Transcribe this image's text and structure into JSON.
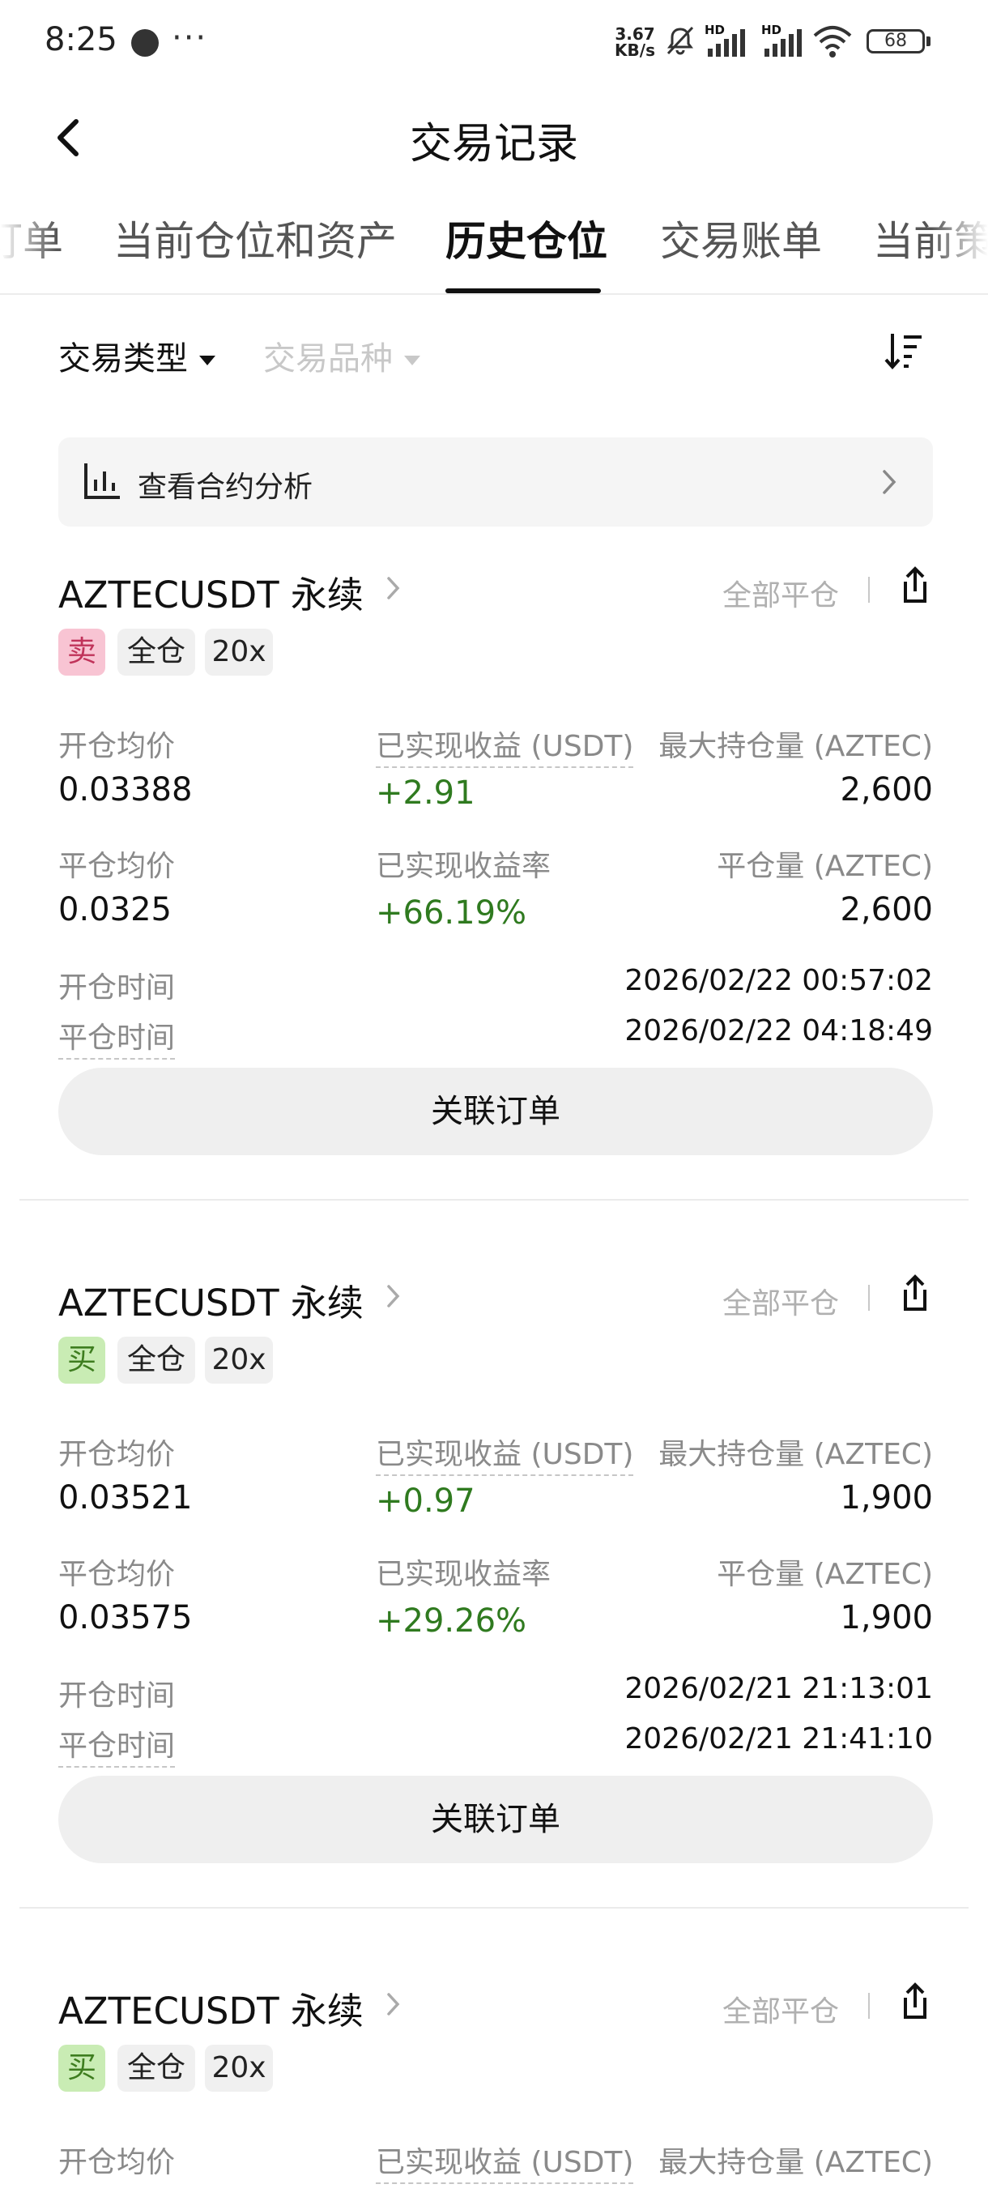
{
  "status_bar": {
    "time": "8:25",
    "dots": "···",
    "speed": "3.67 KB/s",
    "battery": "68",
    "signal1_label": "HD",
    "signal2_label": "HD"
  },
  "nav": {
    "title": "交易记录",
    "back_icon": "chevron-left-icon"
  },
  "tabs": [
    {
      "label": "订单"
    },
    {
      "label": "当前仓位和资产"
    },
    {
      "label": "历史仓位"
    },
    {
      "label": "交易账单"
    },
    {
      "label": "当前策"
    }
  ],
  "filters": {
    "type_label": "交易类型",
    "symbol_label": "交易品种",
    "sort_icon": "sort-descending-icon"
  },
  "analysis": {
    "label": "查看合约分析",
    "icon": "bar-chart-icon"
  },
  "labels": {
    "close_all": "全部平仓",
    "open_avg": "开仓均价",
    "close_avg": "平仓均价",
    "realized_pnl": "已实现收益 (USDT)",
    "realized_rate": "已实现收益率",
    "max_pos": "最大持仓量 (AZTEC)",
    "close_qty": "平仓量 (AZTEC)",
    "open_time": "开仓时间",
    "close_time": "平仓时间",
    "related_orders": "关联订单"
  },
  "positions": [
    {
      "symbol": "AZTECUSDT 永续",
      "side": "卖",
      "side_type": "sell",
      "margin_mode": "全仓",
      "leverage": "20x",
      "open_avg": "0.03388",
      "close_avg": "0.0325",
      "realized_pnl": "+2.91",
      "realized_rate": "+66.19%",
      "max_pos": "2,600",
      "close_qty": "2,600",
      "open_time": "2026/02/22 00:57:02",
      "close_time": "2026/02/22 04:18:49"
    },
    {
      "symbol": "AZTECUSDT 永续",
      "side": "买",
      "side_type": "buy",
      "margin_mode": "全仓",
      "leverage": "20x",
      "open_avg": "0.03521",
      "close_avg": "0.03575",
      "realized_pnl": "+0.97",
      "realized_rate": "+29.26%",
      "max_pos": "1,900",
      "close_qty": "1,900",
      "open_time": "2026/02/21 21:13:01",
      "close_time": "2026/02/21 21:41:10"
    },
    {
      "symbol": "AZTECUSDT 永续",
      "side": "买",
      "side_type": "buy",
      "margin_mode": "全仓",
      "leverage": "20x"
    }
  ],
  "colors": {
    "profit_green": "#2f7a1f",
    "sell_bg": "#f8c4d3",
    "buy_bg": "#c9ecb4"
  }
}
